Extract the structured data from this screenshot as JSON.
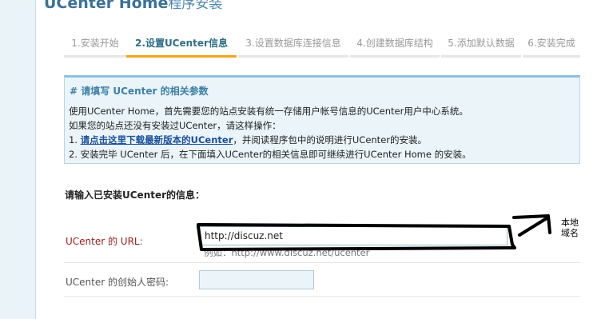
{
  "header": {
    "title_main": "UCenter Home",
    "title_sub": "程序安装"
  },
  "steps": [
    {
      "label": "1.安装开始",
      "active": false
    },
    {
      "label": "2.设置UCenter信息",
      "active": true
    },
    {
      "label": "3.设置数据库连接信息",
      "active": false
    },
    {
      "label": "4.创建数据库结构",
      "active": false
    },
    {
      "label": "5.添加默认数据",
      "active": false
    },
    {
      "label": "6.安装完成",
      "active": false
    }
  ],
  "notice": {
    "title": "# 请填写 UCenter 的相关参数",
    "line1": "使用UCenter Home，首先需要您的站点安装有统一存储用户帐号信息的UCenter用户中心系统。",
    "line2": "如果您的站点还没有安装过UCenter，请这样操作：",
    "line3_prefix": "1. ",
    "line3_link": "请点击这里下载最新版本的UCenter",
    "line3_suffix": "，并阅读程序包中的说明进行UCenter的安装。",
    "line4": "2. 安装完毕 UCenter 后，在下面填入UCenter的相关信息即可继续进行UCenter Home 的安装。"
  },
  "form": {
    "heading": "请输入已安装UCenter的信息：",
    "url_label_hl": "UCenter 的 URL",
    "url_label_colon": ":",
    "url_value": "http://discuz.net",
    "url_example": "例如：http://www.discuz.net/ucenter",
    "password_label": "UCenter 的创始人密码:",
    "password_value": ""
  },
  "annotation": {
    "text": "本地域名"
  },
  "colors": {
    "accent": "#f2a51a",
    "link": "#1a4f9c",
    "notice_bg": "#eaf4f9",
    "title": "#3b7199"
  }
}
